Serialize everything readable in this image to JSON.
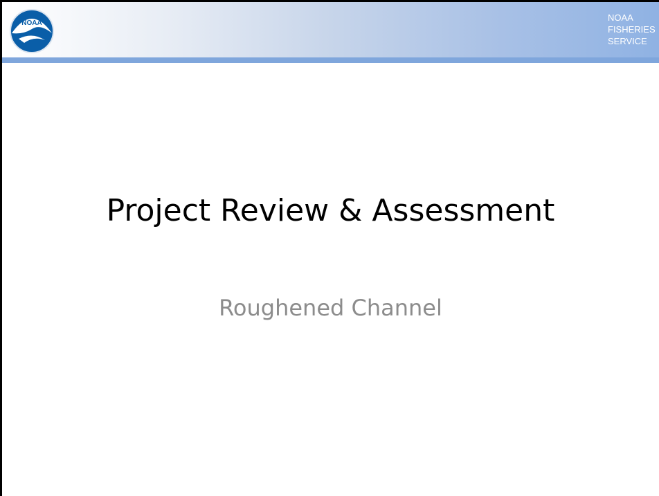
{
  "header": {
    "logo_text": "NOAA",
    "agency_lines": [
      "NOAA",
      "FISHERIES",
      "SERVICE"
    ]
  },
  "slide": {
    "title": "Project Review & Assessment",
    "subtitle": "Roughened Channel"
  },
  "colors": {
    "header_gradient_start": "#ffffff",
    "header_gradient_end": "#8fb2e3",
    "header_rule": "#7fa6dc",
    "logo_blue": "#0a5ea8",
    "title": "#000000",
    "subtitle": "#8c8c8c"
  },
  "icons": {
    "logo": "noaa-logo-icon"
  }
}
